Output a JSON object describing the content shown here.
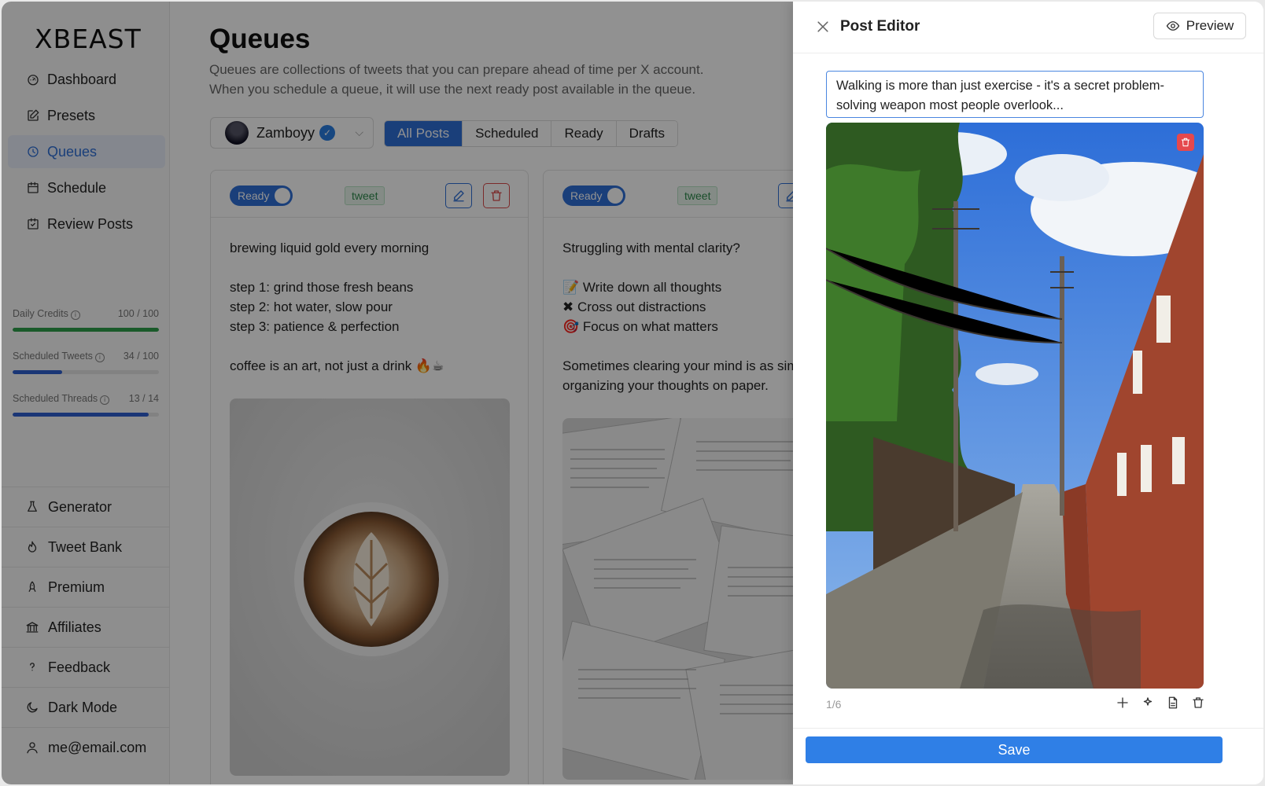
{
  "sidebar": {
    "logo": "XBEAST",
    "nav": [
      {
        "label": "Dashboard",
        "icon": "dashboard-icon"
      },
      {
        "label": "Presets",
        "icon": "edit-square-icon"
      },
      {
        "label": "Queues",
        "icon": "clock-icon"
      },
      {
        "label": "Schedule",
        "icon": "calendar-icon"
      },
      {
        "label": "Review Posts",
        "icon": "check-calendar-icon"
      }
    ],
    "active": "Queues",
    "stats": [
      {
        "label": "Daily Credits",
        "value": "100 / 100",
        "fraction": 1.0,
        "color": "#2e9e4a"
      },
      {
        "label": "Scheduled Tweets",
        "value": "34 / 100",
        "fraction": 0.34,
        "color": "#2f5fd0"
      },
      {
        "label": "Scheduled Threads",
        "value": "13 / 14",
        "fraction": 0.93,
        "color": "#2f5fd0"
      }
    ],
    "bottom": [
      {
        "label": "Generator",
        "icon": "flask-icon"
      },
      {
        "label": "Tweet Bank",
        "icon": "flame-icon"
      },
      {
        "label": "Premium",
        "icon": "rocket-icon"
      },
      {
        "label": "Affiliates",
        "icon": "bank-icon"
      },
      {
        "label": "Feedback",
        "icon": "question-icon"
      },
      {
        "label": "Dark Mode",
        "icon": "moon-icon"
      },
      {
        "label": "me@email.com",
        "icon": "user-icon"
      }
    ]
  },
  "main": {
    "title": "Queues",
    "description_line1": "Queues are collections of tweets that you can prepare ahead of time per X account.",
    "description_line2": "When you schedule a queue, it will use the next ready post available in the queue.",
    "account": "Zamboyy",
    "tabs": [
      "All Posts",
      "Scheduled",
      "Ready",
      "Drafts"
    ],
    "active_tab": "All Posts",
    "cards": [
      {
        "status": "Ready",
        "tag": "tweet",
        "text": "brewing liquid gold every morning\n\nstep 1: grind those fresh beans\nstep 2: hot water, slow pour\nstep 3: patience & perfection\n\ncoffee is an art, not just a drink 🔥☕"
      },
      {
        "status": "Ready",
        "tag": "tweet",
        "text": "Struggling with mental clarity?\n\n📝 Write down all thoughts\n✖ Cross out distractions\n🎯 Focus on what matters\n\nSometimes clearing your mind is as sim\norganizing your thoughts on paper."
      }
    ]
  },
  "editor": {
    "title": "Post Editor",
    "preview_label": "Preview",
    "text": "Walking is more than just exercise - it's a secret problem-solving weapon most people overlook...",
    "pager": "1/6",
    "save_label": "Save"
  }
}
